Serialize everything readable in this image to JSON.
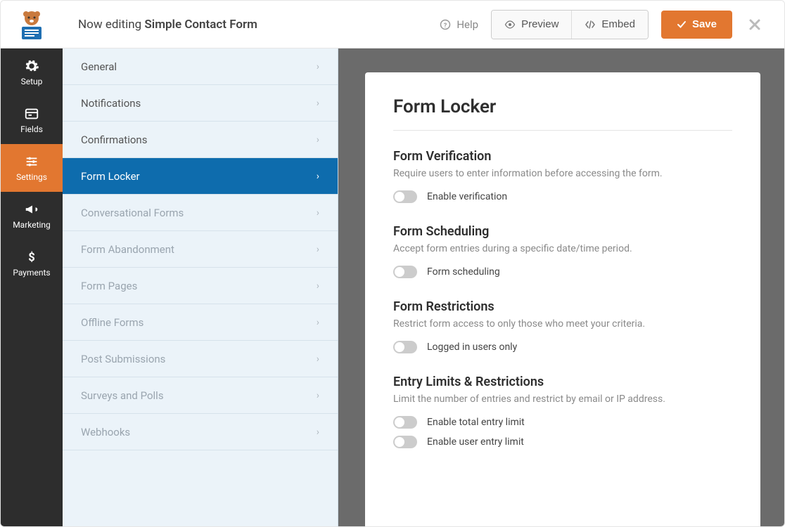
{
  "header": {
    "editing_prefix": "Now editing",
    "form_name": "Simple Contact Form",
    "help_label": "Help",
    "preview_label": "Preview",
    "embed_label": "Embed",
    "save_label": "Save"
  },
  "rail": {
    "items": [
      {
        "label": "Setup",
        "icon": "gear"
      },
      {
        "label": "Fields",
        "icon": "fields"
      },
      {
        "label": "Settings",
        "icon": "sliders",
        "active": true
      },
      {
        "label": "Marketing",
        "icon": "bullhorn"
      },
      {
        "label": "Payments",
        "icon": "dollar"
      }
    ]
  },
  "subnav": {
    "items": [
      {
        "label": "General"
      },
      {
        "label": "Notifications"
      },
      {
        "label": "Confirmations"
      },
      {
        "label": "Form Locker",
        "active": true
      },
      {
        "label": "Conversational Forms",
        "muted": true
      },
      {
        "label": "Form Abandonment",
        "muted": true
      },
      {
        "label": "Form Pages",
        "muted": true
      },
      {
        "label": "Offline Forms",
        "muted": true
      },
      {
        "label": "Post Submissions",
        "muted": true
      },
      {
        "label": "Surveys and Polls",
        "muted": true
      },
      {
        "label": "Webhooks",
        "muted": true
      }
    ]
  },
  "panel": {
    "title": "Form Locker",
    "sections": [
      {
        "heading": "Form Verification",
        "desc": "Require users to enter information before accessing the form.",
        "toggles": [
          {
            "label": "Enable verification",
            "on": false
          }
        ]
      },
      {
        "heading": "Form Scheduling",
        "desc": "Accept form entries during a specific date/time period.",
        "toggles": [
          {
            "label": "Form scheduling",
            "on": false
          }
        ]
      },
      {
        "heading": "Form Restrictions",
        "desc": "Restrict form access to only those who meet your criteria.",
        "toggles": [
          {
            "label": "Logged in users only",
            "on": false
          }
        ]
      },
      {
        "heading": "Entry Limits & Restrictions",
        "desc": "Limit the number of entries and restrict by email or IP address.",
        "toggles": [
          {
            "label": "Enable total entry limit",
            "on": false
          },
          {
            "label": "Enable user entry limit",
            "on": false
          }
        ]
      }
    ]
  }
}
